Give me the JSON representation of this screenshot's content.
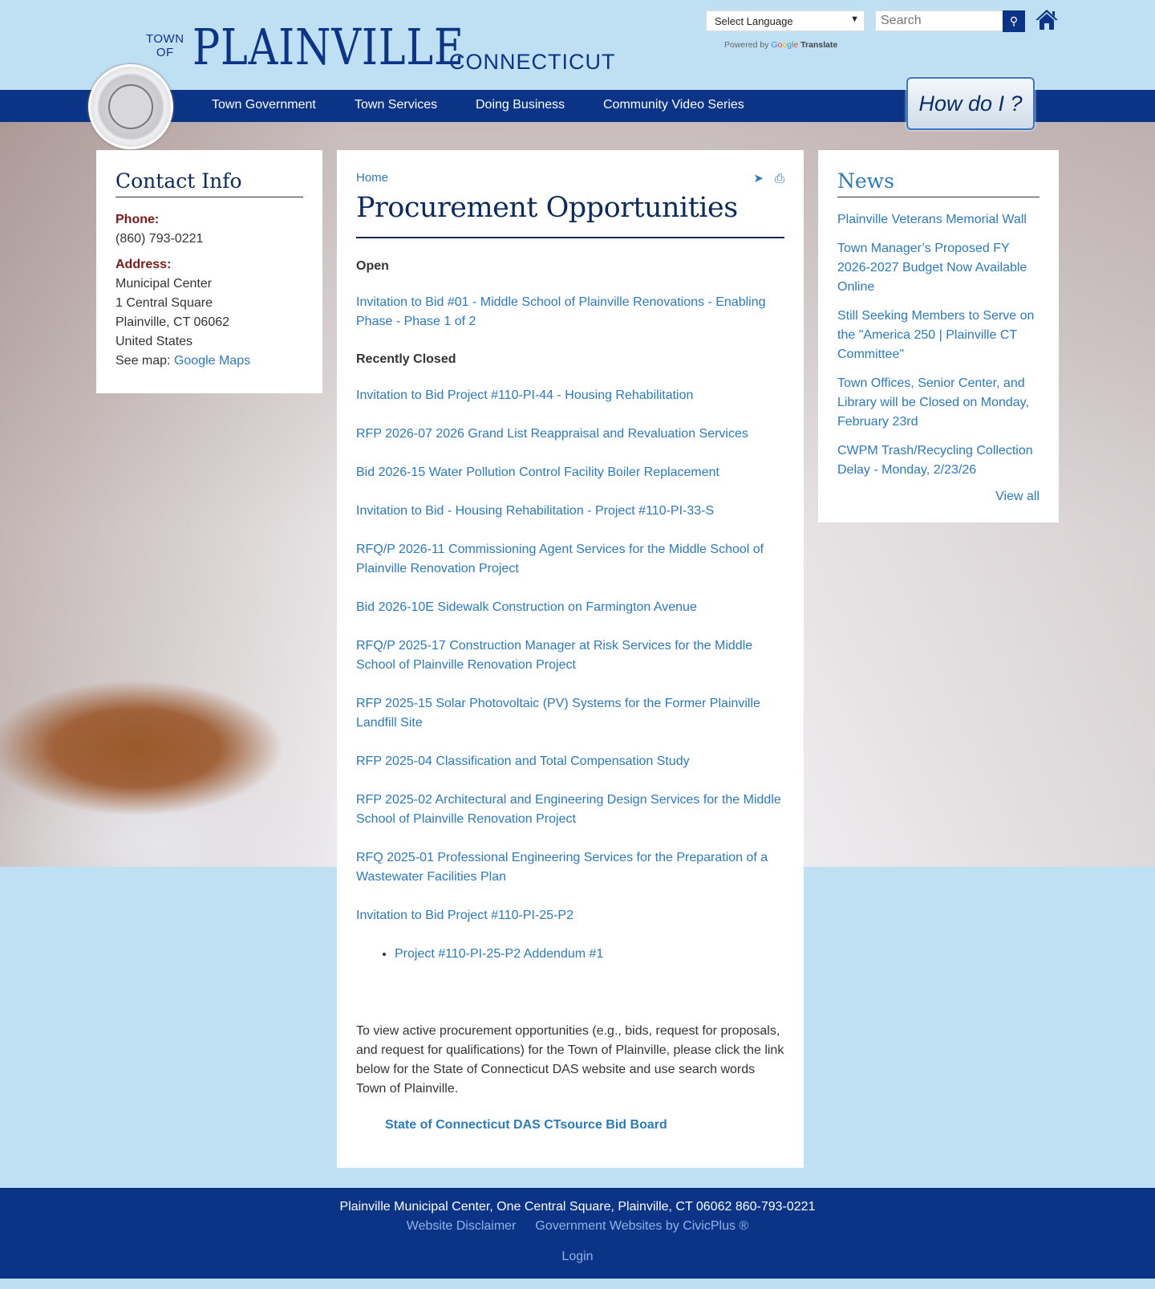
{
  "header": {
    "logo_town": "TOWN",
    "logo_of": "OF",
    "logo_name": "PLAINVILLE",
    "logo_state": "CONNECTICUT",
    "language_select": "Select Language",
    "powered_by": "Powered by",
    "google": "Google",
    "translate": "Translate",
    "search_placeholder": "Search",
    "how_do_i": "How do I ?"
  },
  "nav": [
    "Town Government",
    "Town Services",
    "Doing Business",
    "Community Video Series"
  ],
  "contact": {
    "title": "Contact Info",
    "phone_label": "Phone:",
    "phone": "(860) 793-0221",
    "address_label": "Address:",
    "address": [
      "Municipal Center",
      "1 Central Square",
      "Plainville, CT 06062",
      "United States"
    ],
    "map_prefix": "See map:",
    "map_link": "Google Maps"
  },
  "main": {
    "breadcrumb": "Home",
    "title": "Procurement Opportunities",
    "open_heading": "Open",
    "open": [
      "Invitation to Bid #01 - Middle School of Plainville Renovations - Enabling Phase - Phase 1 of 2"
    ],
    "closed_heading": "Recently Closed",
    "closed": [
      "Invitation to Bid Project #110-PI-44 - Housing Rehabilitation",
      "RFP 2026-07 2026 Grand List Reappraisal and Revaluation Services",
      "Bid 2026-15 Water Pollution Control Facility Boiler Replacement",
      "Invitation to Bid - Housing Rehabilitation - Project #110-PI-33-S",
      "RFQ/P 2026-11 Commissioning Agent Services for the Middle School of Plainville Renovation Project",
      "Bid 2026-10E Sidewalk Construction on Farmington Avenue",
      "RFQ/P 2025-17 Construction Manager at Risk Services for the Middle School of Plainville Renovation Project",
      "RFP 2025-15 Solar Photovoltaic (PV) Systems for the Former Plainville Landfill Site",
      "RFP 2025-04 Classification and Total Compensation Study",
      "RFP 2025-02 Architectural and Engineering Design Services for the Middle School of Plainville Renovation Project",
      "RFQ 2025-01 Professional Engineering Services for the Preparation of a Wastewater Facilities Plan",
      "Invitation to Bid Project #110-PI-25-P2"
    ],
    "addendum": "Project #110-PI-25-P2 Addendum #1",
    "paragraph": "To view active procurement opportunities (e.g., bids, request for proposals, and request for qualifications) for the Town of Plainville, please click the link below for the State of Connecticut DAS website and use search words Town of Plainville.",
    "das_link": "State of Connecticut DAS CTsource Bid Board"
  },
  "news": {
    "title": "News",
    "items": [
      "Plainville Veterans Memorial Wall",
      "Town Manager’s Proposed FY 2026-2027 Budget Now Available Online",
      "Still Seeking Members to Serve on the \"America 250 | Plainville CT Committee\"",
      "Town Offices, Senior Center, and Library will be Closed on Monday, February 23rd",
      "CWPM Trash/Recycling Collection Delay - Monday, 2/23/26"
    ],
    "view_all": "View all"
  },
  "footer": {
    "address": "Plainville Municipal Center, One Central Square, Plainville, CT 06062  860-793-0221",
    "disclaimer": "Website Disclaimer",
    "civicplus": "Government Websites by CivicPlus ®",
    "login": "Login"
  },
  "colors": {
    "navy": "#0b3487",
    "link": "#2a7abf",
    "sky": "#bfdff2"
  }
}
